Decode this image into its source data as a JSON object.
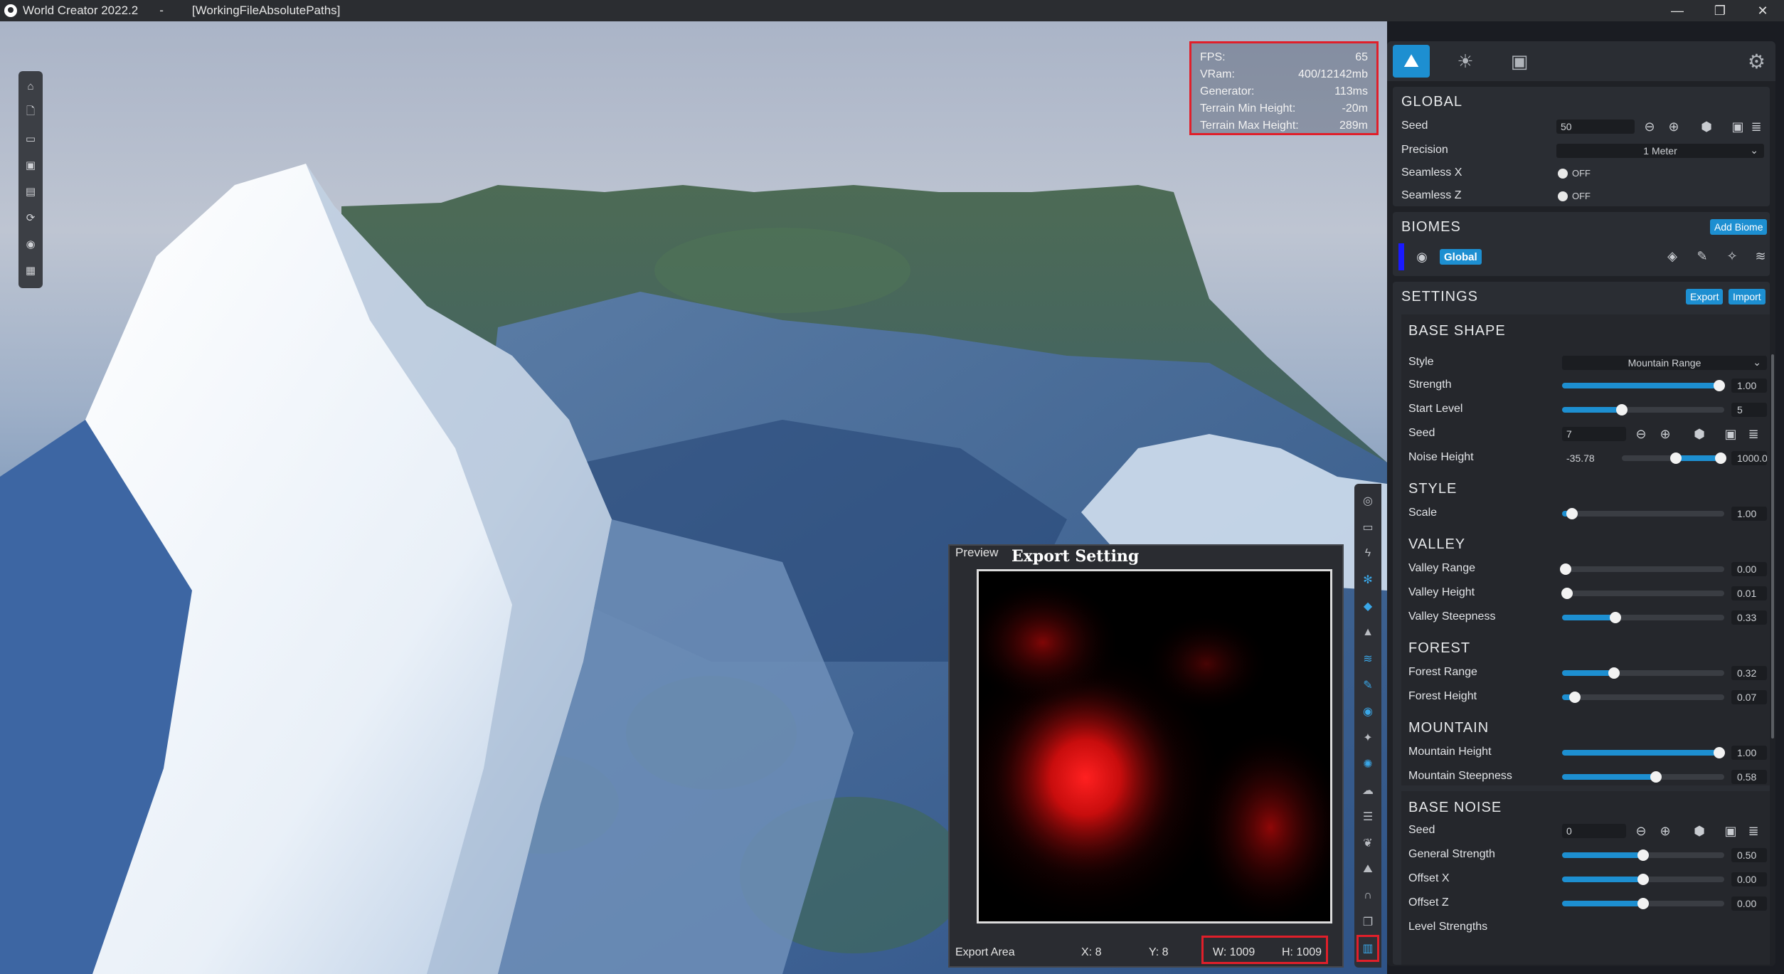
{
  "window": {
    "app_name": "World Creator 2022.2",
    "separator": "-",
    "project": "[WorkingFileAbsolutePaths]",
    "minimize": "—",
    "maximize": "❐",
    "close": "✕"
  },
  "stats": [
    {
      "label": "FPS:",
      "value": "65"
    },
    {
      "label": "VRam:",
      "value": "400/12142mb"
    },
    {
      "label": "Generator:",
      "value": "113ms"
    },
    {
      "label": "Terrain Min Height:",
      "value": "-20m"
    },
    {
      "label": "Terrain Max Height:",
      "value": "289m"
    }
  ],
  "export_panel": {
    "preview_label": "Preview",
    "title": "Export Setting",
    "area_label": "Export Area",
    "x": "X: 8",
    "y": "Y: 8",
    "w": "W: 1009",
    "h": "H: 1009"
  },
  "global": {
    "title": "GLOBAL",
    "seed_label": "Seed",
    "seed_value": "50",
    "precision_label": "Precision",
    "precision_value": "1 Meter",
    "seamless_x_label": "Seamless X",
    "seamless_x_value": "OFF",
    "seamless_z_label": "Seamless Z",
    "seamless_z_value": "OFF"
  },
  "biomes": {
    "title": "BIOMES",
    "add_button": "Add Biome",
    "biome_name": "Global",
    "biome_color": "#1a1aff"
  },
  "settings": {
    "title": "SETTINGS",
    "export_button": "Export",
    "import_button": "Import"
  },
  "base_shape": {
    "title": "BASE  SHAPE",
    "style_label": "Style",
    "style_value": "Mountain Range",
    "strength_label": "Strength",
    "strength_value": "1.00",
    "strength_level": 0.97,
    "start_level_label": "Start Level",
    "start_level_value": "5",
    "start_level_level": 0.37,
    "seed_label": "Seed",
    "seed_value": "7",
    "noise_height_label": "Noise Height",
    "noise_height_min": "-35.78",
    "noise_height_max": "1000.0"
  },
  "style": {
    "title": "STYLE",
    "scale_label": "Scale",
    "scale_value": "1.00",
    "scale_level": 0.06
  },
  "valley": {
    "title": "VALLEY",
    "range_label": "Valley Range",
    "range_value": "0.00",
    "range_level": 0.02,
    "height_label": "Valley Height",
    "height_value": "0.01",
    "height_level": 0.03,
    "steepness_label": "Valley Steepness",
    "steepness_value": "0.33",
    "steepness_level": 0.33
  },
  "forest": {
    "title": "FOREST",
    "range_label": "Forest Range",
    "range_value": "0.32",
    "range_level": 0.32,
    "height_label": "Forest Height",
    "height_value": "0.07",
    "height_level": 0.08
  },
  "mountain": {
    "title": "MOUNTAIN",
    "height_label": "Mountain Height",
    "height_value": "1.00",
    "height_level": 0.97,
    "steepness_label": "Mountain Steepness",
    "steepness_value": "0.58",
    "steepness_level": 0.58
  },
  "base_noise": {
    "title": "BASE  NOISE",
    "seed_label": "Seed",
    "seed_value": "0",
    "general_label": "General Strength",
    "general_value": "0.50",
    "general_level": 0.5,
    "offset_x_label": "Offset X",
    "offset_x_value": "0.00",
    "offset_x_level": 0.5,
    "offset_z_label": "Offset Z",
    "offset_z_value": "0.00",
    "offset_z_level": 0.5,
    "level_strengths_label": "Level Strengths"
  },
  "colors": {
    "accent": "#1d8fd1",
    "highlight": "#e01f2a"
  }
}
